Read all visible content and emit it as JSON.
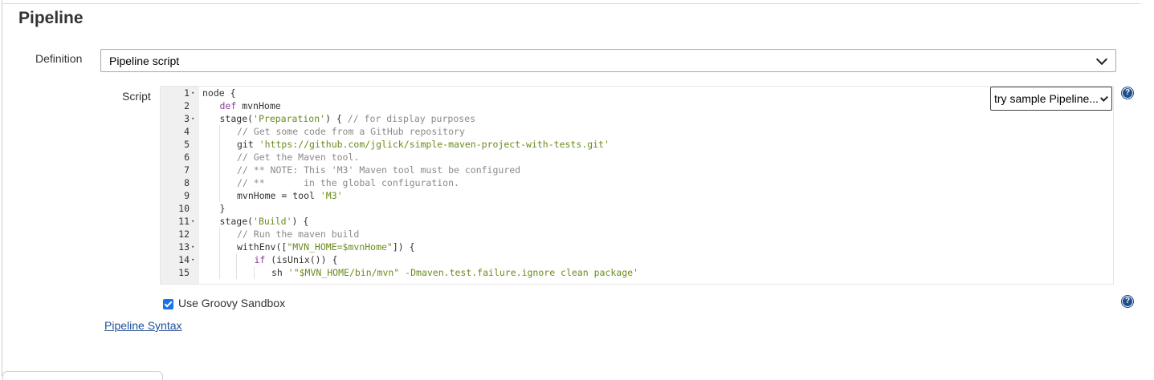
{
  "section": {
    "title": "Pipeline"
  },
  "definition": {
    "label": "Definition",
    "selected": "Pipeline script"
  },
  "script": {
    "label": "Script",
    "sample_select": "try sample Pipeline...",
    "line_numbers": [
      "1",
      "2",
      "3",
      "4",
      "5",
      "6",
      "7",
      "8",
      "9",
      "10",
      "11",
      "12",
      "13",
      "14",
      "15"
    ],
    "lines": [
      {
        "indent": 0,
        "fold": true,
        "tokens": [
          {
            "t": "node {",
            "c": ""
          }
        ]
      },
      {
        "indent": 1,
        "fold": false,
        "tokens": [
          {
            "t": "def",
            "c": "kw"
          },
          {
            "t": " mvnHome",
            "c": ""
          }
        ]
      },
      {
        "indent": 1,
        "fold": true,
        "tokens": [
          {
            "t": "stage(",
            "c": ""
          },
          {
            "t": "'Preparation'",
            "c": "str"
          },
          {
            "t": ") { ",
            "c": ""
          },
          {
            "t": "// for display purposes",
            "c": "cm"
          }
        ]
      },
      {
        "indent": 2,
        "fold": false,
        "tokens": [
          {
            "t": "// Get some code from a GitHub repository",
            "c": "cm"
          }
        ]
      },
      {
        "indent": 2,
        "fold": false,
        "tokens": [
          {
            "t": "git ",
            "c": ""
          },
          {
            "t": "'https://github.com/jglick/simple-maven-project-with-tests.git'",
            "c": "str"
          }
        ]
      },
      {
        "indent": 2,
        "fold": false,
        "tokens": [
          {
            "t": "// Get the Maven tool.",
            "c": "cm"
          }
        ]
      },
      {
        "indent": 2,
        "fold": false,
        "tokens": [
          {
            "t": "// ** NOTE: This 'M3' Maven tool must be configured",
            "c": "cm"
          }
        ]
      },
      {
        "indent": 2,
        "fold": false,
        "tokens": [
          {
            "t": "// **       in the global configuration.",
            "c": "cm"
          }
        ]
      },
      {
        "indent": 2,
        "fold": false,
        "tokens": [
          {
            "t": "mvnHome = tool ",
            "c": ""
          },
          {
            "t": "'M3'",
            "c": "str"
          }
        ]
      },
      {
        "indent": 1,
        "fold": false,
        "tokens": [
          {
            "t": "}",
            "c": ""
          }
        ]
      },
      {
        "indent": 1,
        "fold": true,
        "tokens": [
          {
            "t": "stage(",
            "c": ""
          },
          {
            "t": "'Build'",
            "c": "str"
          },
          {
            "t": ") {",
            "c": ""
          }
        ]
      },
      {
        "indent": 2,
        "fold": false,
        "tokens": [
          {
            "t": "// Run the maven build",
            "c": "cm"
          }
        ]
      },
      {
        "indent": 2,
        "fold": true,
        "tokens": [
          {
            "t": "withEnv([",
            "c": ""
          },
          {
            "t": "\"MVN_HOME=$mvnHome\"",
            "c": "str"
          },
          {
            "t": "]) {",
            "c": ""
          }
        ]
      },
      {
        "indent": 3,
        "fold": true,
        "tokens": [
          {
            "t": "if",
            "c": "kw"
          },
          {
            "t": " (isUnix()) {",
            "c": ""
          }
        ]
      },
      {
        "indent": 4,
        "fold": false,
        "tokens": [
          {
            "t": "sh ",
            "c": ""
          },
          {
            "t": "'\"$MVN_HOME/bin/mvn\" -Dmaven.test.failure.ignore clean package'",
            "c": "str"
          }
        ]
      }
    ]
  },
  "sandbox": {
    "label": "Use Groovy Sandbox",
    "checked": true
  },
  "links": {
    "pipeline_syntax": "Pipeline Syntax"
  },
  "help_icon_glyph": "?",
  "icons": {
    "help": "help-icon",
    "fold": "fold-arrow-icon",
    "checkbox": "checkbox-checked-icon"
  }
}
